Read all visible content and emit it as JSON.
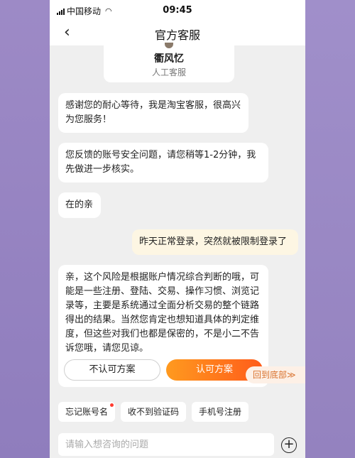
{
  "status_bar": {
    "carrier": "中国移动",
    "time": "09:45"
  },
  "nav": {
    "back_icon": "‹",
    "title": "官方客服"
  },
  "agent": {
    "name": "衢风忆",
    "role": "人工客服"
  },
  "messages": [
    {
      "side": "left",
      "text": "感谢您的耐心等待，我是淘宝客服，很高兴为您服务！"
    },
    {
      "side": "left",
      "text": "您反馈的账号安全问题，请您稍等1-2分钟，我先做进一步核实。"
    },
    {
      "side": "left",
      "text": "在的亲"
    },
    {
      "side": "right",
      "text": "昨天正常登录，突然就被限制登录了"
    },
    {
      "side": "left",
      "text": "亲，这个风险是根据账户情况综合判断的哦，可能是一些注册、登陆、交易、操作习惯、浏览记录等，主要是系统通过全面分析交易的整个链路得出的结果。当然您肯定也想知道具体的判定维度，但这些对我们也都是保密的，不是小二不告诉您哦，请您见谅。"
    }
  ],
  "actions": {
    "reject_label": "不认可方案",
    "accept_label": "认可方案"
  },
  "back_to_bottom": "回到底部≫",
  "quick_replies": [
    "忘记账号名",
    "收不到验证码",
    "手机号注册"
  ],
  "input": {
    "placeholder": "请输入想咨询的问题",
    "plus_icon": "+"
  },
  "colors": {
    "accent_orange": "#ff5c1a",
    "accent_orange_light": "#ff9a1f",
    "background": "#efefef",
    "frame": "#9b88c3"
  }
}
